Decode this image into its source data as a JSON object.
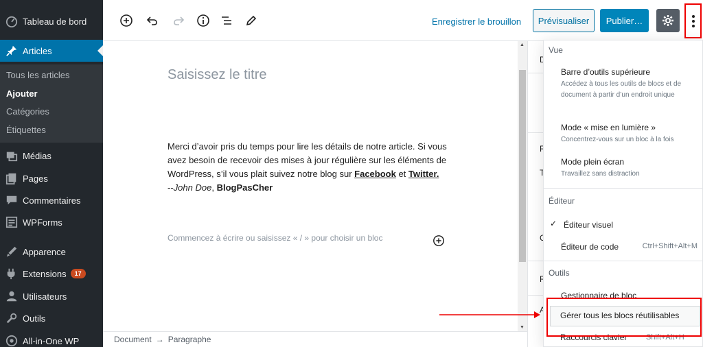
{
  "sidebar": {
    "items": [
      {
        "label": "Tableau de bord",
        "icon": "dashboard-icon"
      },
      {
        "label": "Articles",
        "icon": "pin-icon"
      },
      {
        "label": "Médias",
        "icon": "media-icon"
      },
      {
        "label": "Pages",
        "icon": "pages-icon"
      },
      {
        "label": "Commentaires",
        "icon": "comments-icon"
      },
      {
        "label": "WPForms",
        "icon": "wpforms-icon"
      },
      {
        "label": "Apparence",
        "icon": "appearance-icon"
      },
      {
        "label": "Extensions",
        "icon": "plugins-icon",
        "badge": "17"
      },
      {
        "label": "Utilisateurs",
        "icon": "users-icon"
      },
      {
        "label": "Outils",
        "icon": "tools-icon"
      },
      {
        "label": "All-in-One WP",
        "icon": "aiowp-icon"
      }
    ],
    "submenu": [
      "Tous les articles",
      "Ajouter",
      "Catégories",
      "Étiquettes"
    ]
  },
  "toolbar": {
    "save_draft": "Enregistrer le brouillon",
    "preview": "Prévisualiser",
    "publish": "Publier…"
  },
  "editor": {
    "title_placeholder": "Saisissez le titre",
    "para_text1": "Merci d’avoir pris du temps pour lire les détails de notre article. Si vous avez besoin de recevoir des mises à jour régulière sur les éléments de WordPress, s’il vous plait suivez notre blog sur ",
    "link_facebook": "Facebook",
    "para_and": " et ",
    "link_twitter": "Twitter.",
    "signature_dash": "--",
    "author": "John Doe",
    "comma": ", ",
    "blog_name": "BlogPasCher",
    "block_placeholder": "Commencez à écrire ou saisissez « / » pour choisir un bloc"
  },
  "footer": {
    "breadcrumb": [
      "Document",
      "→",
      "Paragraphe"
    ]
  },
  "settings_sidebar": {
    "fragments": [
      "D",
      "R",
      "T",
      "C",
      "R",
      "A"
    ]
  },
  "dropdown": {
    "section_view": "Vue",
    "top_toolbar": "Barre d’outils supérieure",
    "top_toolbar_desc": "Accédez à tous les outils de blocs et de document à partir d’un endroit unique",
    "spotlight": "Mode « mise en lumière »",
    "spotlight_desc": "Concentrez-vous sur un bloc à la fois",
    "fullscreen": "Mode plein écran",
    "fullscreen_desc": "Travaillez sans distraction",
    "section_editor": "Éditeur",
    "visual_editor": "Éditeur visuel",
    "check": "✓",
    "code_editor": "Éditeur de code",
    "code_editor_shortcut": "Ctrl+Shift+Alt+M",
    "section_tools": "Outils",
    "block_manager": "Gestionnaire de bloc",
    "manage_reusable": "Gérer tous les blocs réutilisables",
    "keyboard_shortcuts": "Raccourcis clavier",
    "keyboard_shortcuts_key": "Shift+Alt+H"
  },
  "colors": {
    "sidebar_bg": "#23282d",
    "accent": "#0073aa",
    "annotation_red": "#ee0000"
  }
}
